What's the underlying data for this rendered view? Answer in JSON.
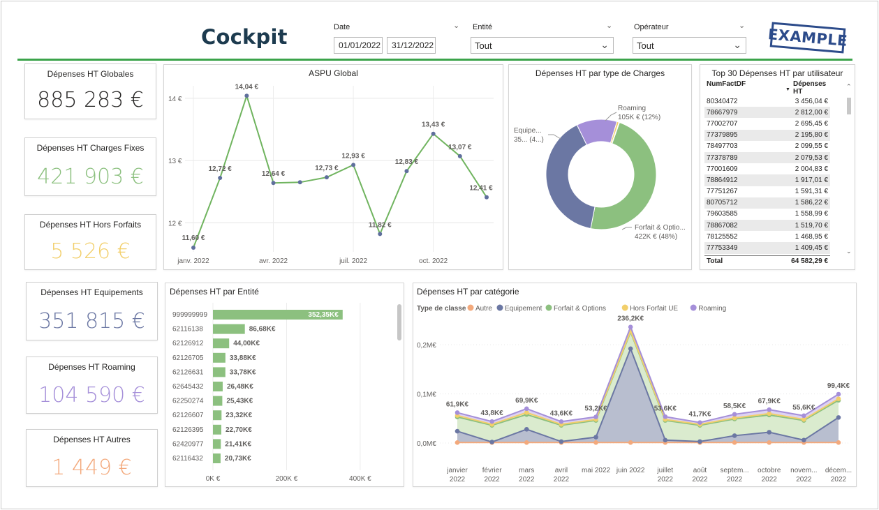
{
  "header": {
    "title": "Cockpit",
    "stamp": "EXAMPLE",
    "date_label": "Date",
    "date_start": "01/01/2022",
    "date_end": "31/12/2022",
    "entity_label": "Entité",
    "entity_value": "Tout",
    "operator_label": "Opérateur",
    "operator_value": "Tout"
  },
  "kpis": [
    {
      "title": "Dépenses HT Globales",
      "value": "885 283 €",
      "color": "#252423"
    },
    {
      "title": "Dépenses HT Charges Fixes",
      "value": "421 903 €",
      "color": "#8cc07f"
    },
    {
      "title": "Dépenses HT Hors Forfaits",
      "value": "5 526 €",
      "color": "#f2cf6b"
    },
    {
      "title": "Dépenses HT Equipements",
      "value": "351 815 €",
      "color": "#6b77a3"
    },
    {
      "title": "Dépenses HT Roaming",
      "value": "104 590 €",
      "color": "#a58fd9"
    },
    {
      "title": "Dépenses HT Autres",
      "value": "1 449 €",
      "color": "#f3a97c"
    }
  ],
  "aspu": {
    "title": "ASPU Global"
  },
  "donut": {
    "title": "Dépenses HT par type de Charges"
  },
  "top30": {
    "title": "Top 30 Dépenses HT par utilisateur",
    "col1": "NumFactDF",
    "col2": "Dépenses HT",
    "rows": [
      [
        "80340472",
        "3 456,04 €"
      ],
      [
        "78667979",
        "2 812,00 €"
      ],
      [
        "77002707",
        "2 695,45 €"
      ],
      [
        "77379895",
        "2 195,80 €"
      ],
      [
        "78497703",
        "2 099,55 €"
      ],
      [
        "77378789",
        "2 079,53 €"
      ],
      [
        "77001609",
        "2 004,83 €"
      ],
      [
        "78864912",
        "1 917,01 €"
      ],
      [
        "77751267",
        "1 591,31 €"
      ],
      [
        "80705712",
        "1 586,22 €"
      ],
      [
        "79603585",
        "1 558,99 €"
      ],
      [
        "78867082",
        "1 519,70 €"
      ],
      [
        "78125552",
        "1 468,95 €"
      ],
      [
        "77753349",
        "1 409,45 €"
      ]
    ],
    "total_label": "Total",
    "total_value": "64 582,29 €"
  },
  "entity": {
    "title": "Dépenses HT par Entité"
  },
  "category": {
    "title": "Dépenses HT par catégorie",
    "legend_title": "Type de classe"
  },
  "chart_data": [
    {
      "type": "line",
      "title": "ASPU Global",
      "x": [
        "janv. 2022",
        "févr. 2022",
        "mars 2022",
        "avr. 2022",
        "mai 2022",
        "juin 2022",
        "juil. 2022",
        "août 2022",
        "sept. 2022",
        "oct. 2022",
        "nov. 2022",
        "déc. 2022"
      ],
      "x_ticks": [
        "janv. 2022",
        "avr. 2022",
        "juil. 2022",
        "oct. 2022"
      ],
      "values": [
        11.6,
        12.72,
        14.04,
        12.64,
        12.65,
        12.73,
        12.93,
        11.82,
        12.83,
        13.43,
        13.07,
        12.41
      ],
      "labels": [
        "11,60 €",
        "12,72 €",
        "14,04 €",
        "12,64 €",
        "",
        "12,73 €",
        "12,93 €",
        "11,82 €",
        "12,83 €",
        "13,43 €",
        "13,07 €",
        "12,41 €"
      ],
      "y_ticks": [
        "12 €",
        "13 €",
        "14 €"
      ],
      "ylim": [
        11.6,
        14.2
      ],
      "color": "#70b45f"
    },
    {
      "type": "pie",
      "title": "Dépenses HT par type de Charges",
      "donut": true,
      "slices": [
        {
          "name": "Forfait & Options",
          "value": 422,
          "label": "Forfait & Optio...",
          "sub": "422K € (48%)",
          "color": "#8cc07f"
        },
        {
          "name": "Equipement",
          "value": 352,
          "label": "Equipe...",
          "sub": "35... (4...)",
          "color": "#6b77a3"
        },
        {
          "name": "Roaming",
          "value": 105,
          "label": "Roaming",
          "sub": "105K € (12%)",
          "color": "#a58fd9"
        },
        {
          "name": "Hors Forfait UE",
          "value": 5.5,
          "label": "",
          "sub": "",
          "color": "#f2cf6b"
        },
        {
          "name": "Autre",
          "value": 1.4,
          "label": "",
          "sub": "",
          "color": "#f3a97c"
        }
      ]
    },
    {
      "type": "bar",
      "orientation": "horizontal",
      "title": "Dépenses HT par Entité",
      "categories": [
        "999999999",
        "62116138",
        "62126912",
        "62126705",
        "62126631",
        "62645432",
        "62250274",
        "62126607",
        "62126395",
        "62420977",
        "62116432"
      ],
      "values": [
        352.35,
        86.68,
        44.0,
        33.88,
        33.78,
        26.48,
        25.43,
        23.32,
        22.7,
        21.41,
        20.73
      ],
      "labels": [
        "352,35K€",
        "86,68K€",
        "44,00K€",
        "33,88K€",
        "33,78K€",
        "26,48K€",
        "25,43K€",
        "23,32K€",
        "22,70K€",
        "21,41K€",
        "20,73K€"
      ],
      "x_ticks": [
        "0K €",
        "200K €",
        "400K €"
      ],
      "xlim": [
        0,
        440
      ],
      "color": "#8cc07f"
    },
    {
      "type": "area",
      "title": "Dépenses HT par catégorie",
      "categories": [
        "janvier 2022",
        "février 2022",
        "mars 2022",
        "avril 2022",
        "mai 2022",
        "juin 2022",
        "juillet 2022",
        "août 2022",
        "septem... 2022",
        "octobre 2022",
        "novem... 2022",
        "décem... 2022"
      ],
      "y_ticks": [
        "0,0M€",
        "0,1M€",
        "0,2M€"
      ],
      "ylim": [
        0,
        0.24
      ],
      "series": [
        {
          "name": "Autre",
          "color": "#f3a97c",
          "values": [
            0.001,
            0.001,
            0.001,
            0.001,
            0.001,
            0.001,
            0.001,
            0.001,
            0.001,
            0.001,
            0.001,
            0.001
          ]
        },
        {
          "name": "Equipement",
          "color": "#6b77a3",
          "values": [
            0.024,
            0.002,
            0.028,
            0.003,
            0.012,
            0.192,
            0.006,
            0.003,
            0.015,
            0.022,
            0.006,
            0.052
          ]
        },
        {
          "name": "Forfait & Options",
          "color": "#8cc07f",
          "values": [
            0.053,
            0.036,
            0.058,
            0.036,
            0.046,
            0.226,
            0.046,
            0.036,
            0.049,
            0.057,
            0.046,
            0.087
          ]
        },
        {
          "name": "Hors Forfait UE",
          "color": "#f2cf6b",
          "values": [
            0.056,
            0.038,
            0.062,
            0.038,
            0.048,
            0.228,
            0.048,
            0.038,
            0.051,
            0.06,
            0.048,
            0.09
          ]
        },
        {
          "name": "Roaming",
          "color": "#a58fd9",
          "values": [
            0.0619,
            0.0438,
            0.0699,
            0.0436,
            0.0532,
            0.2362,
            0.0536,
            0.0417,
            0.0585,
            0.0679,
            0.0556,
            0.0994
          ]
        }
      ],
      "top_labels": [
        "61,9K€",
        "43,8K€",
        "69,9K€",
        "43,6K€",
        "53,2K€",
        "236,2K€",
        "53,6K€",
        "41,7K€",
        "58,5K€",
        "67,9K€",
        "55,6K€",
        "99,4K€"
      ]
    }
  ]
}
